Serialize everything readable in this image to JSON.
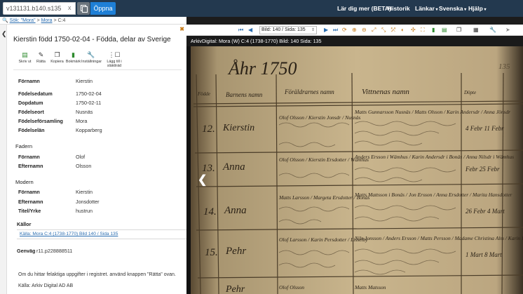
{
  "topbar": {
    "search_value": "v131131.b140.s135",
    "clear_label": "x",
    "open_button": "Öppna",
    "menu": [
      {
        "label": "Lär dig mer (BETA)",
        "dropdown": false
      },
      {
        "label": "Historik",
        "dropdown": false
      },
      {
        "label": "Länkar",
        "dropdown": true
      },
      {
        "label": "Svenska",
        "dropdown": true
      },
      {
        "label": "Hjälp",
        "dropdown": true
      }
    ]
  },
  "breadcrumb": {
    "prefix": "Sök:",
    "query": "\"Mora\"",
    "sep1": ">",
    "place": "Mora",
    "sep2": ">",
    "volume": "C:4"
  },
  "panel": {
    "title": "Kierstin född 1750-02-04 - Födda, delar av Sverige",
    "tools": [
      {
        "label": "Skriv ut",
        "icon": "printer-icon",
        "color": "#2e8b2e"
      },
      {
        "label": "Rätta",
        "icon": "pencil-icon",
        "color": "#333333"
      },
      {
        "label": "Kopiera",
        "icon": "copy-icon",
        "color": "#333333"
      },
      {
        "label": "Bokmärk",
        "icon": "bookmark-icon",
        "color": "#2e8b2e"
      },
      {
        "label": "Inställningar",
        "icon": "wrench-icon",
        "color": "#333333"
      },
      {
        "label": "Lägg till i släktträd",
        "icon": "tree-icon",
        "color": "#333333"
      }
    ],
    "person": [
      {
        "label": "Förnamn",
        "value": "Kierstin"
      },
      {
        "label": "Födelsedatum",
        "value": "1750-02-04"
      },
      {
        "label": "Dopdatum",
        "value": "1750-02-11"
      },
      {
        "label": "Födelseort",
        "value": "Nusnäs"
      },
      {
        "label": "Födelseförsamling",
        "value": "Mora"
      },
      {
        "label": "Födelselän",
        "value": "Kopparberg"
      }
    ],
    "father_heading": "Fadern",
    "father": [
      {
        "label": "Förnamn",
        "value": "Olof"
      },
      {
        "label": "Efternamn",
        "value": "Olsson"
      }
    ],
    "mother_heading": "Modern",
    "mother": [
      {
        "label": "Förnamn",
        "value": "Kierstin"
      },
      {
        "label": "Efternamn",
        "value": "Jonsdotter"
      },
      {
        "label": "Titel/Yrke",
        "value": "hustrun"
      }
    ],
    "sources_heading": "Källor",
    "source_link": "Källa: Mora C:4 (1738-1770) Bild 140 / Sida 135",
    "shortcut_label": "Genväg",
    "shortcut_value": "r11.p228888511",
    "note": "Om du hittar felaktiga uppgifter i registret. använd knappen \"Rätta\" ovan.",
    "credit": "Källa: Arkiv Digital AD AB"
  },
  "viewer": {
    "page_select": "Bild: 140 / Sida: 135",
    "image_title": "ArkivDigital: Mora (W) C:4 (1738-1770) Bild: 140 Sida: 135",
    "accent": "#2a6db0"
  },
  "manuscript": {
    "year": "Åhr 1750",
    "page_no": "135",
    "col_headers": [
      "Födde",
      "Barnens namn",
      "Föräldrarnes namn",
      "Vittnenas namn",
      "Döpte"
    ],
    "entries": [
      {
        "day": "12.",
        "child": "Kierstin",
        "parents": "Olof Olsson / Kierstin Jonsdr / Nusnäs",
        "witnesses": "Matts Gunnarsson Nusnäs / Matts Olsson / Karin Andersdr / Anna Jönsdr",
        "baptized": "4 Febr 11 Febr"
      },
      {
        "day": "13.",
        "child": "Anna",
        "parents": "Olof Olsson / Kierstin Ersdotter / Wämhus",
        "witnesses": "Anders Ersson i Wämhus / Karin Andersdr i Bonäs / Anna Nilsdr i Wämhus",
        "baptized": "Febr 25 Febr"
      },
      {
        "day": "14.",
        "child": "Anna",
        "parents": "Matts Larsson / Margeta Ersdotter / Bonäs",
        "witnesses": "Matts Mattsson i Bonäs / Jon Ersson / Anna Ersdotter / Marita Hansdotter",
        "baptized": "26 Febr 4 Mart"
      },
      {
        "day": "15.",
        "child": "Pehr",
        "parents": "Olof Larsson / Karin Persdotter / Lisselby",
        "witnesses": "Nils Jonsson / Anders Ersson / Matts Persson / Madame Christina Alm / Karin Persdr",
        "baptized": "1 Mart 8 Mart"
      },
      {
        "day": "",
        "child": "Pehr",
        "parents": "Olof Olsson",
        "witnesses": "Matts Matsson",
        "baptized": ""
      }
    ]
  }
}
